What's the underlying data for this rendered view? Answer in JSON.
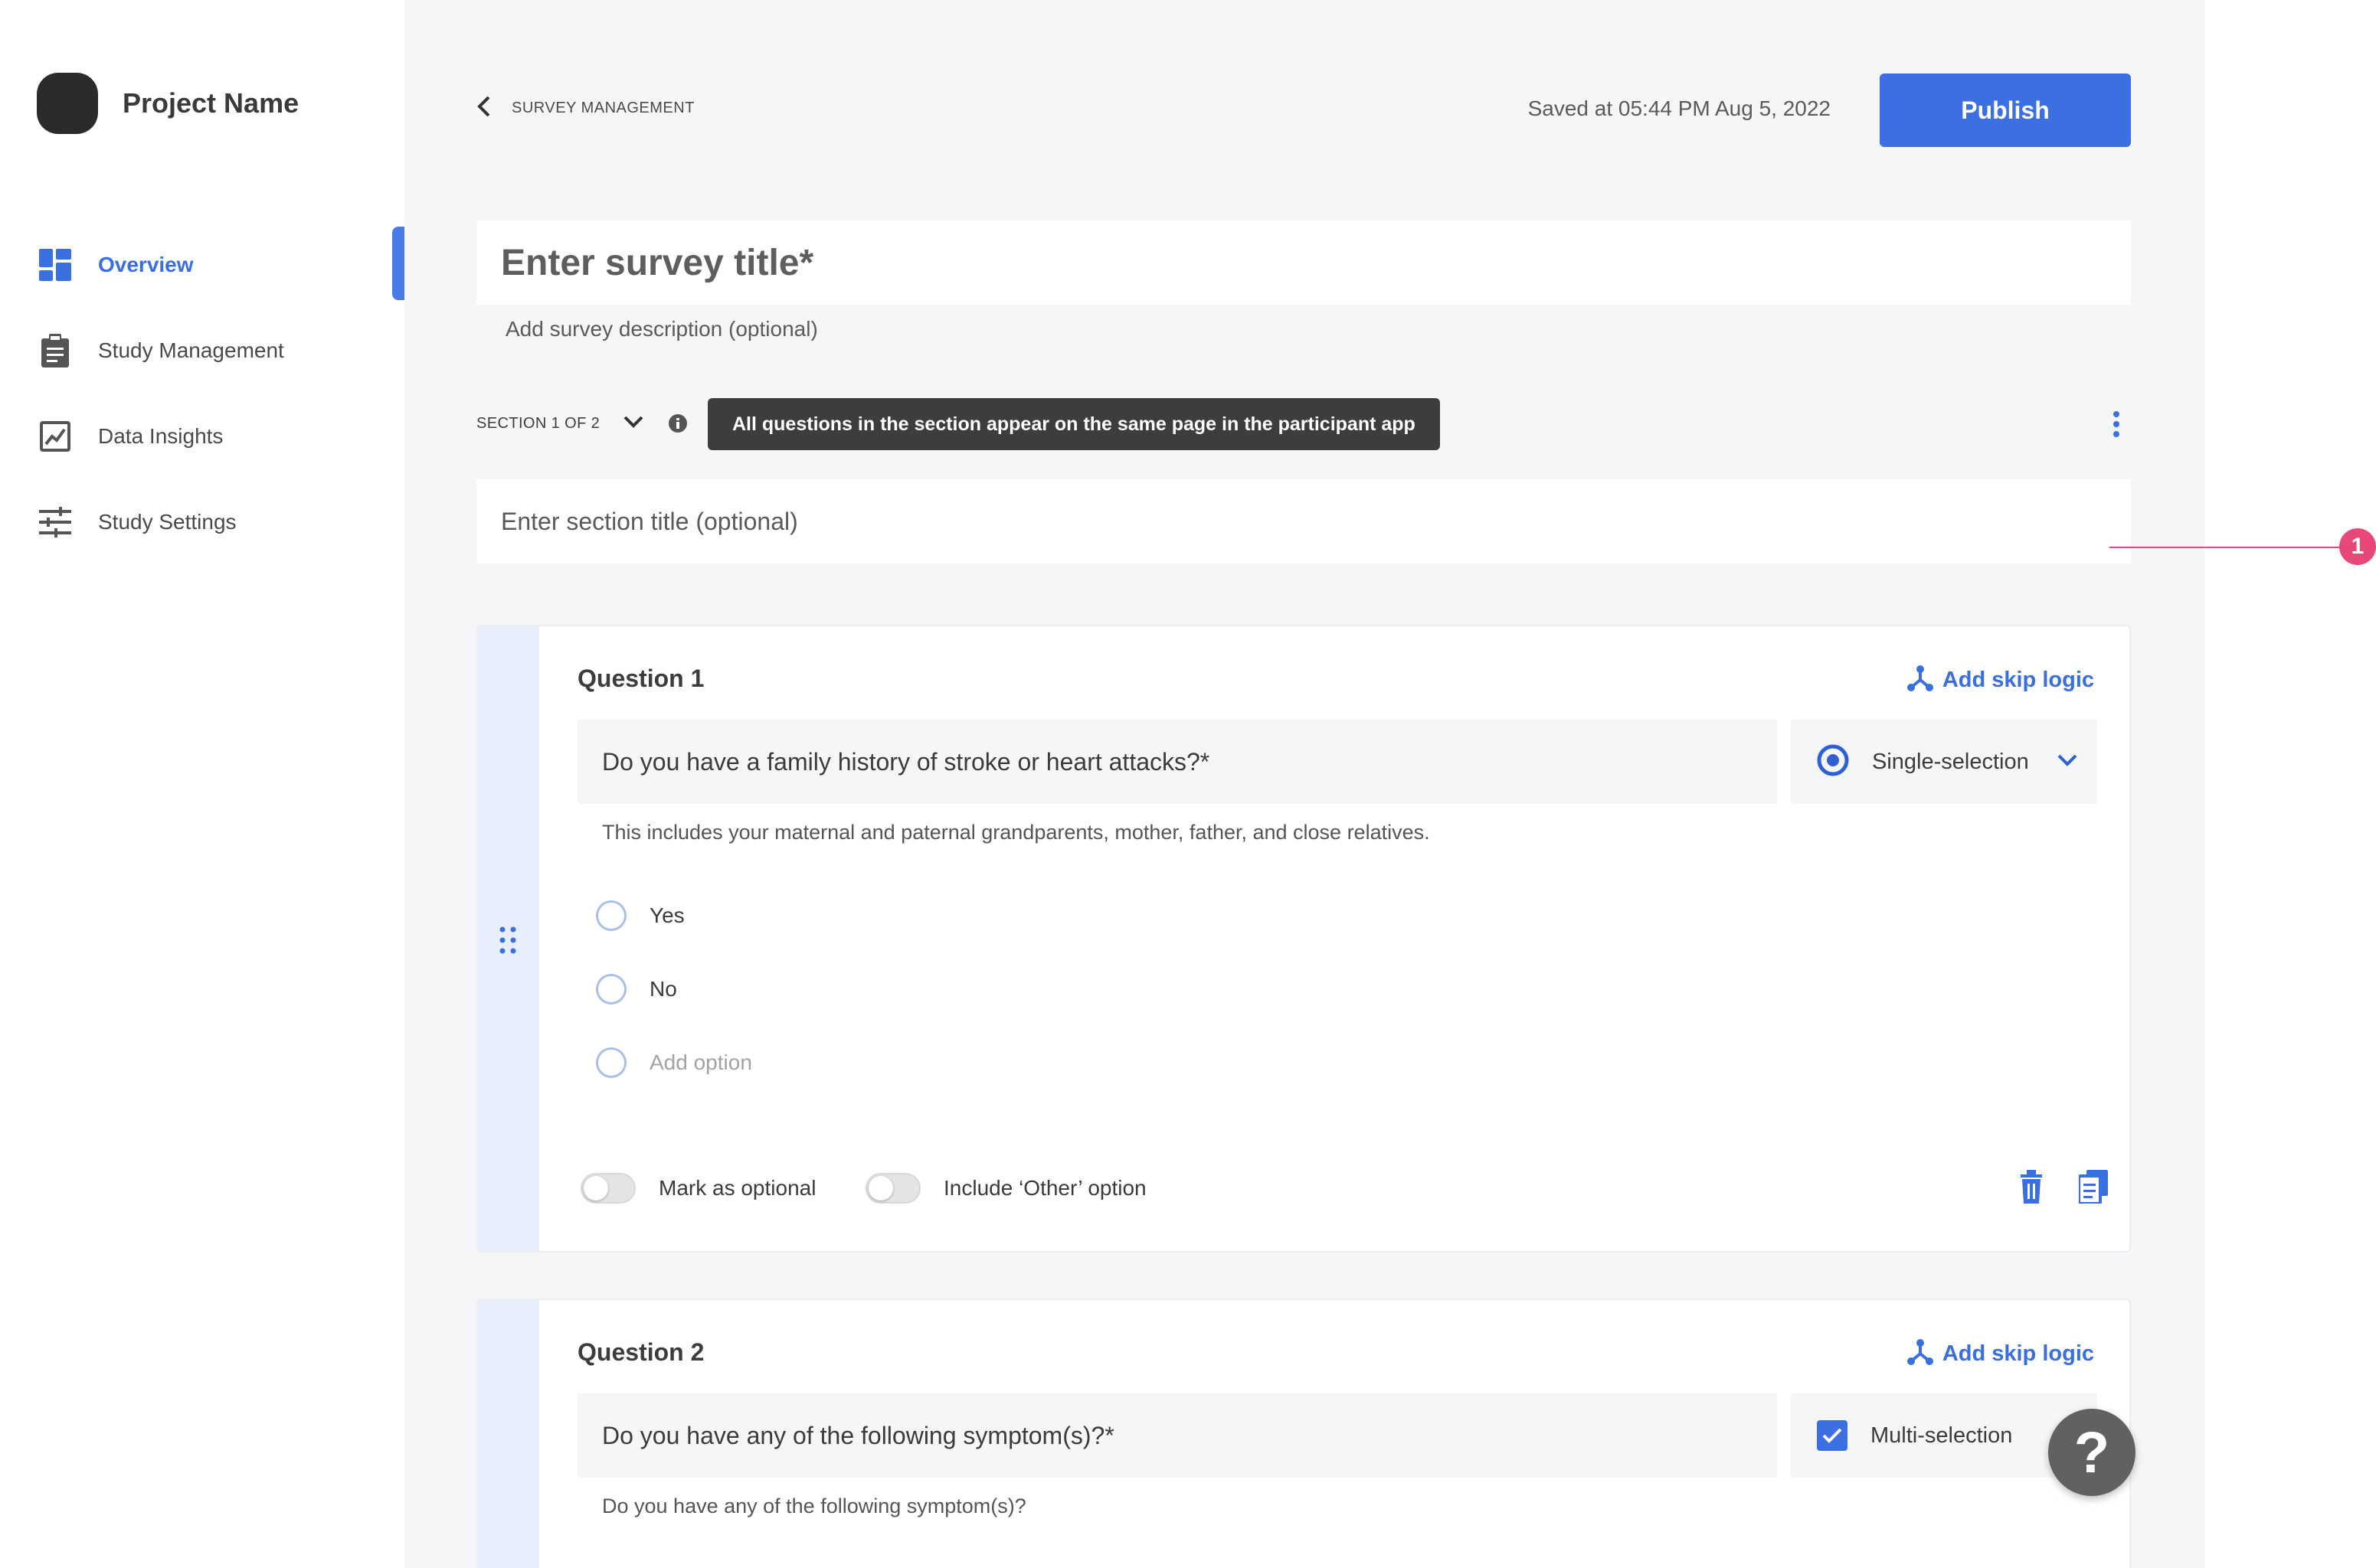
{
  "brand": {
    "name": "Project Name"
  },
  "sidebar": {
    "items": [
      {
        "label": "Overview",
        "icon": "dashboard-icon",
        "active": true
      },
      {
        "label": "Study Management",
        "icon": "clipboard-icon",
        "active": false
      },
      {
        "label": "Data Insights",
        "icon": "chart-icon",
        "active": false
      },
      {
        "label": "Study Settings",
        "icon": "sliders-icon",
        "active": false
      }
    ]
  },
  "header": {
    "back_label": "SURVEY MANAGEMENT",
    "saved_text": "Saved at 05:44 PM Aug 5, 2022",
    "publish_label": "Publish"
  },
  "survey": {
    "title_placeholder": "Enter survey title*",
    "description_placeholder": "Add survey description (optional)"
  },
  "section": {
    "label": "SECTION 1 OF 2",
    "tooltip": "All questions in the section appear on the same page in the participant app",
    "title_placeholder": "Enter section title (optional)"
  },
  "annotation": {
    "number": "1"
  },
  "questions": [
    {
      "title": "Question 1",
      "skip_logic_label": "Add skip logic",
      "text": "Do you have a family history of stroke or heart attacks?*",
      "type_label": "Single-selection",
      "description": "This includes your maternal and paternal grandparents, mother, father, and close relatives.",
      "options": [
        "Yes",
        "No"
      ],
      "add_option_placeholder": "Add option",
      "optional_label": "Mark as optional",
      "other_label": "Include ‘Other’ option"
    },
    {
      "title": "Question 2",
      "skip_logic_label": "Add skip logic",
      "text": "Do you have any of the following symptom(s)?*",
      "type_label": "Multi-selection",
      "description": "Do you have any of the following symptom(s)?"
    }
  ],
  "help": {
    "symbol": "?"
  },
  "colors": {
    "accent": "#3b6fe2",
    "annotation": "#e8477a",
    "sidebar_active": "#3a6fe0"
  }
}
